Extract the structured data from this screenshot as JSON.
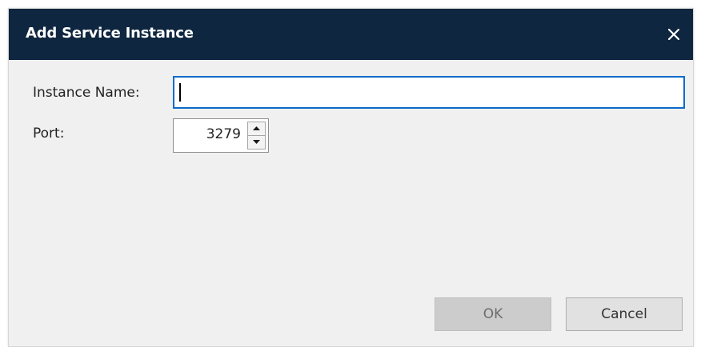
{
  "dialog": {
    "title": "Add Service Instance",
    "close_icon": "close-icon"
  },
  "form": {
    "instance_name_label": "Instance Name:",
    "instance_name_value": "",
    "port_label": "Port:",
    "port_value": "3279"
  },
  "buttons": {
    "ok_label": "OK",
    "cancel_label": "Cancel",
    "ok_enabled": false
  },
  "colors": {
    "titlebar": "#0f2640",
    "focus_border": "#0b6cc9"
  }
}
